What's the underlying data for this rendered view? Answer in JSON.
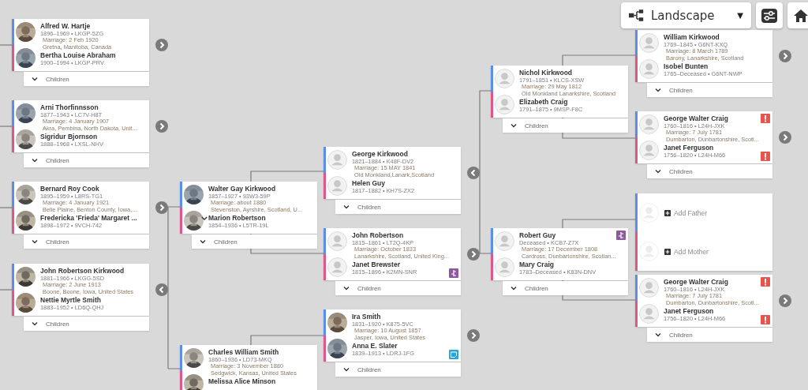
{
  "toolbar": {
    "layout_label": "Landscape",
    "caret": "▼"
  },
  "columns": [
    {
      "cards": [
        {
          "kind": "couple",
          "father": {
            "name": "Alfred W. Hartje",
            "dates": "1896–1969 • LKGP-5ZG",
            "photo": true
          },
          "marriage": [
            "Marriage: 2 Feb 1920",
            "Gretna, Manitoba, Canada"
          ],
          "mother": {
            "name": "Bertha Louise Abraham",
            "dates": "1900–1994 • LKGP-PRV",
            "photo": true
          },
          "children_label": "Children",
          "nav": {
            "kind": "next"
          }
        },
        {
          "kind": "couple",
          "father": {
            "name": "Arni Thorfinnsson",
            "dates": "1877–1943 • LC7V-H8T",
            "photo": true
          },
          "marriage": [
            "Marriage: 4 January 1907",
            "Akra, Pembina, North Dakota, Unit..."
          ],
          "mother": {
            "name": "Sigridur Bjornson",
            "dates": "1888–1968 • LXSL-NHV",
            "photo": true
          },
          "children_label": "Children",
          "nav": {
            "kind": "next"
          }
        },
        {
          "kind": "couple",
          "father": {
            "name": "Bernard Roy Cook",
            "dates": "1895–1959 • L8RS-TG1",
            "photo": true
          },
          "marriage": [
            "Marriage: 4 January 1921",
            "Belle Plaine, Benton County, Iowa,..."
          ],
          "mother": {
            "name": "Fredericka 'Frieda' Margaret ...",
            "dates": "1898–1972 • 9VCH-742",
            "photo": true
          },
          "children_label": "Children",
          "nav": {
            "kind": "next"
          }
        },
        {
          "kind": "couple",
          "father": {
            "name": "John Robertson Kirkwood",
            "dates": "1881–1966 • LKGG-5SD",
            "photo": true
          },
          "marriage": [
            "Marriage: 2 June 1913",
            "Boone, Boone, Iowa, United States"
          ],
          "mother": {
            "name": "Nettie Myrtle Smith",
            "dates": "1883–1952 • LD6Q-QHJ",
            "photo": true
          },
          "children_label": "Children",
          "nav": {
            "kind": "back"
          }
        }
      ]
    },
    {
      "cards": [
        {
          "kind": "couple",
          "father": {
            "name": "Walter Gay Kirkwood",
            "dates": "1857–1927 • 93W3-59P",
            "photo": true
          },
          "marriage": [
            "Marriage: about 1880",
            "Stevenston, Ayrshire, Scotland, U..."
          ],
          "mother": {
            "name": "Marion Robertson",
            "dates": "1854–1936 • L5TR-19L",
            "photo": true,
            "caret": true
          },
          "children_label": "Children"
        },
        {
          "kind": "couple",
          "father": {
            "name": "Charles William Smith",
            "dates": "1860–1936 • LD73-MKQ",
            "photo": true
          },
          "marriage": [
            "Marriage: 3 November 1880",
            "Sedgwick, Kansas, United States"
          ],
          "mother": {
            "name": "Melissa Alice Minson",
            "photo": true
          }
        }
      ]
    },
    {
      "cards": [
        {
          "kind": "couple",
          "father": {
            "name": "George Kirkwood",
            "dates": "1821–1884 • K48F-DV2",
            "photo": false
          },
          "marriage": [
            "Marriage: 15 MAY 1841",
            "Old Monkland,Lanark,Scotland"
          ],
          "mother": {
            "name": "Helen Guy",
            "dates": "1817–1882 • KH7S-ZX2",
            "photo": false
          },
          "children_label": "Children",
          "nav": {
            "kind": "back"
          }
        },
        {
          "kind": "couple",
          "father": {
            "name": "John Robertson",
            "dates": "1815–1861 • LT2Q-4KP",
            "photo": false
          },
          "marriage": [
            "Marriage: October 1833",
            "Lanarkshire, Scotland, United King..."
          ],
          "mother": {
            "name": "Janet Brewster",
            "dates": "1815–1896 • K2MN-SNR",
            "photo": false,
            "badge": {
              "kind": "branch"
            }
          },
          "children_label": "Children",
          "nav": {
            "kind": "next"
          }
        },
        {
          "kind": "couple",
          "father": {
            "name": "Ira Smith",
            "dates": "1831–1920 • K875-5VC",
            "photo": true
          },
          "marriage": [
            "Marriage: 10 August 1857",
            "Jasper, Iowa, United States"
          ],
          "mother": {
            "name": "Anna E. Slater",
            "dates": "1839–1913 • LDRJ-1FG",
            "photo": true,
            "badge": {
              "kind": "note"
            }
          },
          "children_label": "Children",
          "nav": {
            "kind": "next"
          }
        }
      ]
    },
    {
      "cards": [
        {
          "kind": "couple",
          "father": {
            "name": "Nichol Kirkwood",
            "dates": "1791–1851 • KLCS-XSW",
            "photo": false
          },
          "marriage": [
            "Marriage: 29 May 1812",
            "Old Monkland Lanarkshire, Scotland"
          ],
          "mother": {
            "name": "Elizabeth Craig",
            "dates": "1791–1875 • 9MSP-F8C",
            "photo": false
          },
          "children_label": "Children"
        },
        {
          "kind": "couple",
          "father": {
            "name": "Robert Guy",
            "dates": "Deceased • KCB7-Z7X",
            "photo": false,
            "badge": {
              "kind": "branch"
            }
          },
          "marriage": [
            "Marriage: 17 December 1808",
            "Cardross, Dunbartonshire, Scotlan..."
          ],
          "mother": {
            "name": "Mary Craig",
            "dates": "1783–Deceased • K83N-DNV",
            "photo": false
          },
          "children_label": "Children"
        }
      ]
    },
    {
      "cards": [
        {
          "kind": "couple",
          "father": {
            "name": "William Kirkwood",
            "dates": "1769–1845 • G6NT-KXQ",
            "photo": false
          },
          "marriage": [
            "Marriage: 8 March 1789",
            "Barony, Lanarkshire, Scotland"
          ],
          "mother": {
            "name": "Isobel Bunten",
            "dates": "1765–Deceased • G6NT-NWP",
            "photo": false
          },
          "children_label": "Children",
          "nav": {
            "kind": "next"
          }
        },
        {
          "kind": "couple",
          "father": {
            "name": "George Walter Craig",
            "dates": "1760–1816 • L24H-JXK",
            "photo": false,
            "badge": {
              "kind": "alert"
            }
          },
          "marriage": [
            "Marriage: 7 July 1781",
            "Dumbarton, Dunbartonshire, Scotl..."
          ],
          "mother": {
            "name": "Janet Ferguson",
            "dates": "1756–1820 • L24H-M66",
            "photo": false,
            "badge": {
              "kind": "alert"
            }
          },
          "children_label": "Children",
          "nav": {
            "kind": "next"
          }
        },
        {
          "kind": "add",
          "father_action": "Add Father",
          "mother_action": "Add Mother"
        },
        {
          "kind": "couple",
          "father": {
            "name": "George Walter Craig",
            "dates": "1760–1816 • L24H-JXK",
            "photo": false,
            "badge": {
              "kind": "alert"
            }
          },
          "marriage": [
            "Marriage: 7 July 1781",
            "Dumbarton, Dunbartonshire, Scotl..."
          ],
          "mother": {
            "name": "Janet Ferguson",
            "dates": "1756–1820 • L24H-M66",
            "photo": false,
            "badge": {
              "kind": "alert"
            }
          },
          "children_label": "Children",
          "nav": {
            "kind": "next"
          }
        }
      ]
    }
  ]
}
